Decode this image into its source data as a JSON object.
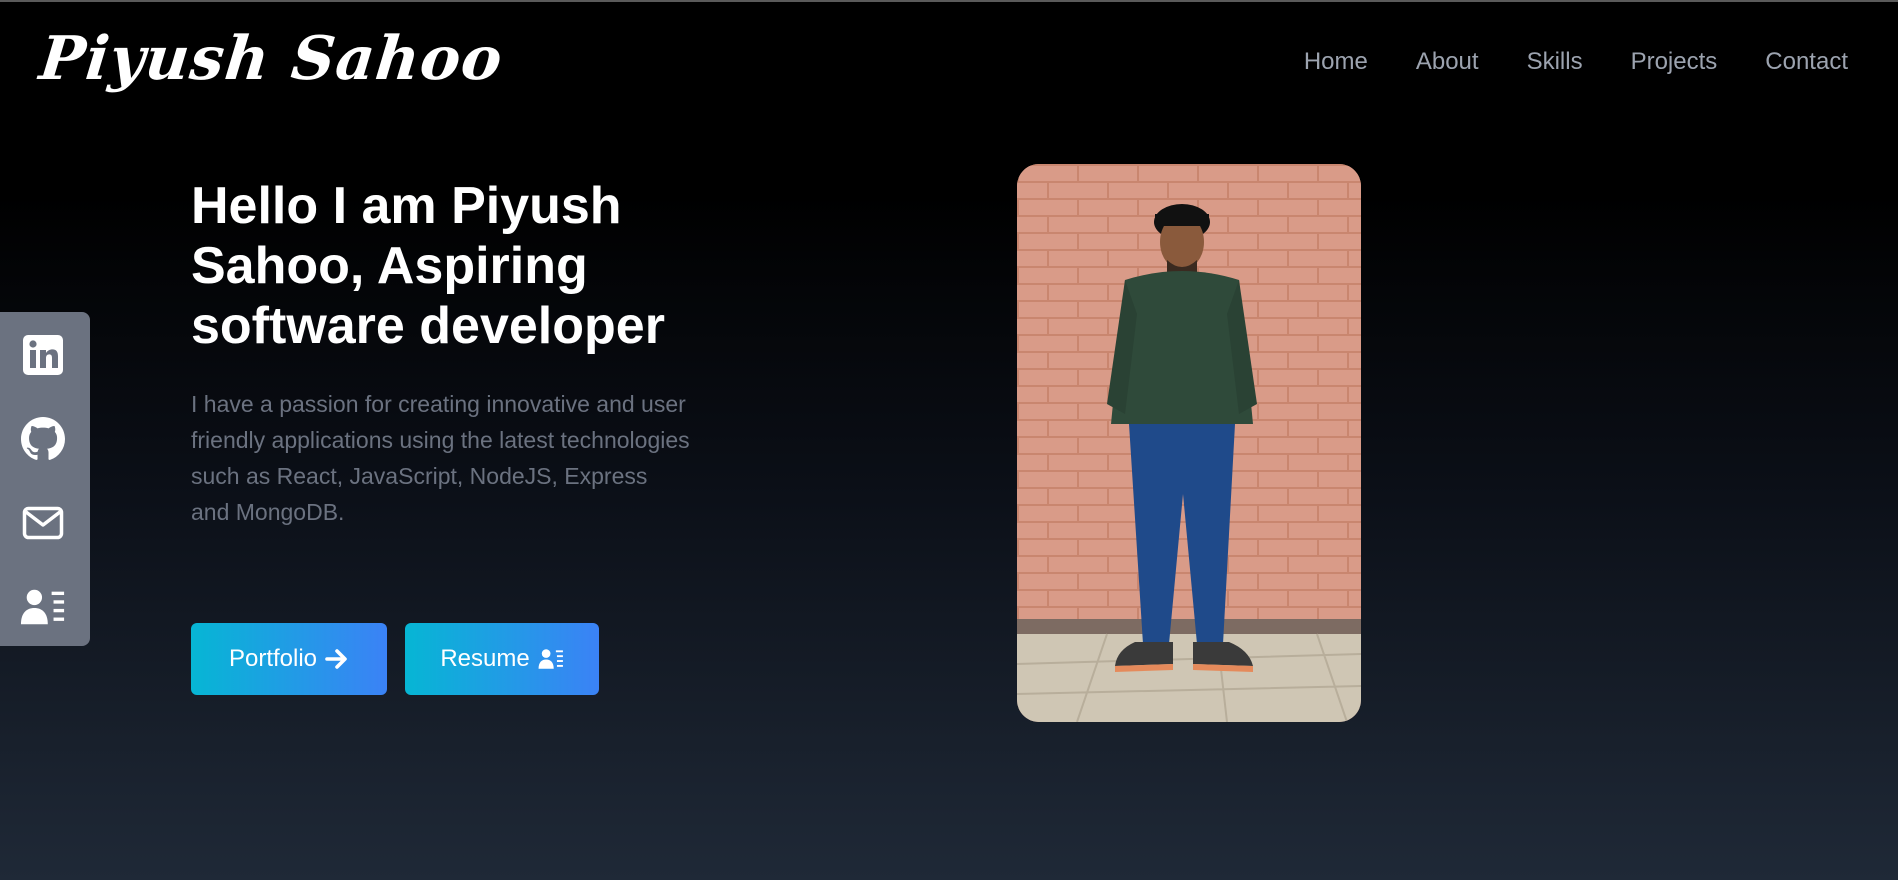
{
  "brand": {
    "logo_text": "Piyush Sahoo"
  },
  "nav": {
    "items": [
      {
        "label": "Home"
      },
      {
        "label": "About"
      },
      {
        "label": "Skills"
      },
      {
        "label": "Projects"
      },
      {
        "label": "Contact"
      }
    ]
  },
  "social": {
    "items": [
      {
        "icon": "linkedin-icon"
      },
      {
        "icon": "github-icon"
      },
      {
        "icon": "mail-icon"
      },
      {
        "icon": "resume-icon"
      }
    ]
  },
  "hero": {
    "title": "Hello I am Piyush Sahoo, Aspiring software developer",
    "description": "I have a passion for creating innovative and user friendly applications using the latest technologies such as React, JavaScript, NodeJS, Express and MongoDB.",
    "buttons": {
      "portfolio_label": "Portfolio",
      "resume_label": "Resume"
    },
    "photo_alt": "Piyush Sahoo standing in front of a pink brick wall"
  },
  "colors": {
    "accent_gradient_start": "#06b6d4",
    "accent_gradient_end": "#3b82f6",
    "social_bar": "#6b7280",
    "nav_text": "#9ca3af"
  }
}
